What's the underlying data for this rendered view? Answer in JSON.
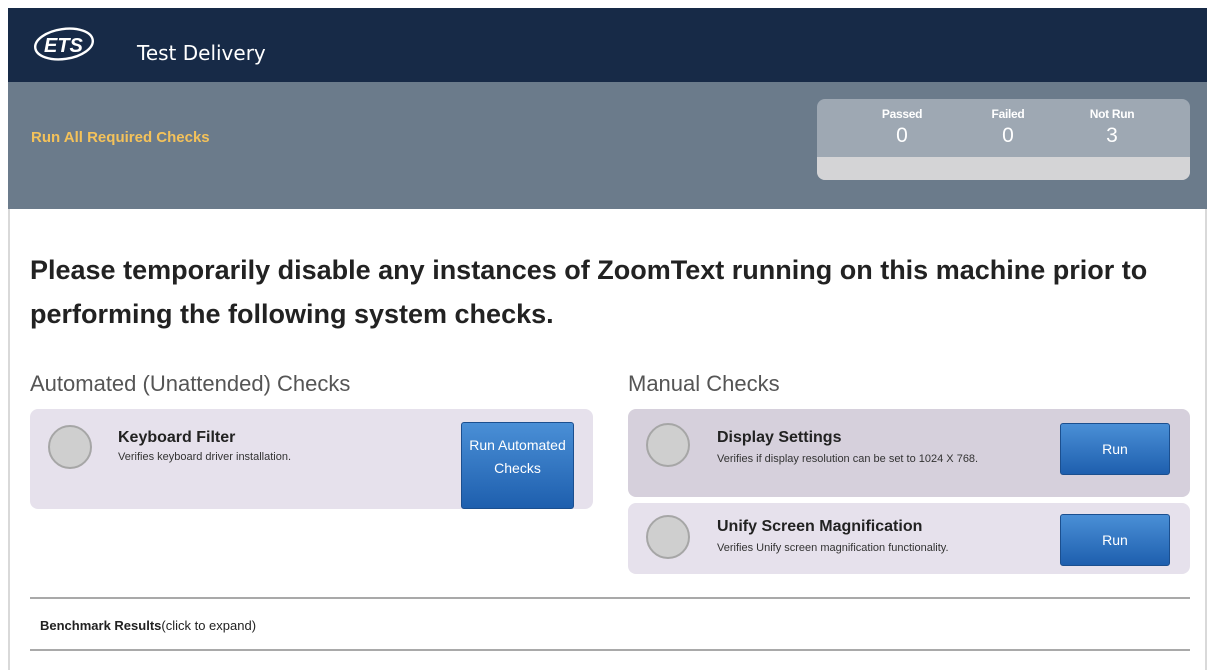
{
  "header": {
    "logo_text": "ETS",
    "app_title": "Test Delivery"
  },
  "summary": {
    "run_all_label": "Run All Required Checks",
    "stats": [
      {
        "label": "Passed",
        "value": "0"
      },
      {
        "label": "Failed",
        "value": "0"
      },
      {
        "label": "Not Run",
        "value": "3"
      }
    ]
  },
  "warning_text": "Please temporarily disable any instances of ZoomText running on this machine prior to performing the following system checks.",
  "automated": {
    "title": "Automated (Unattended) Checks",
    "checks": [
      {
        "name": "Keyboard Filter",
        "description": "Verifies keyboard driver installation."
      }
    ],
    "run_button": "Run Automated Checks"
  },
  "manual": {
    "title": "Manual Checks",
    "checks": [
      {
        "name": "Display Settings",
        "description": "Verifies if display resolution can be set to 1024 X 768.",
        "button": "Run"
      },
      {
        "name": "Unify Screen Magnification",
        "description": "Verifies Unify screen magnification functionality.",
        "button": "Run"
      }
    ]
  },
  "benchmark": {
    "label": "Benchmark Results",
    "hint": "(click to expand)"
  }
}
